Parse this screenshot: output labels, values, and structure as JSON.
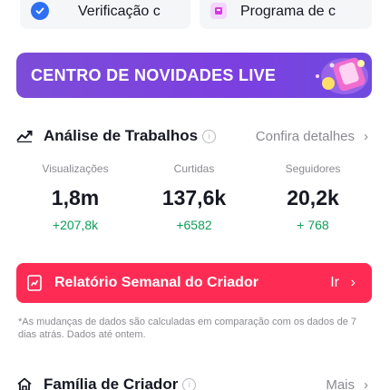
{
  "top_cards": {
    "verification_label": "Verificação c",
    "program_label": "Programa de c"
  },
  "live_banner": {
    "text": "CENTRO DE NOVIDADES LIVE"
  },
  "work_analysis": {
    "title": "Análise de Trabalhos",
    "link": "Confira detalhes",
    "stats": [
      {
        "label": "Visualizações",
        "value": "1,8m",
        "delta": "+207,8k"
      },
      {
        "label": "Curtidas",
        "value": "137,6k",
        "delta": "+6582"
      },
      {
        "label": "Seguidores",
        "value": "20,2k",
        "delta": "+ 768"
      }
    ],
    "delta_color": "#0f9d58"
  },
  "weekly_report": {
    "label": "Relatório Semanal do Criador",
    "action": "Ir",
    "color": "#fe2c55"
  },
  "footnote": "*As mudanças de dados são calculadas em comparação com os dados de 7 dias atrás. Dados até ontem.",
  "creator_family": {
    "title": "Família de Criador",
    "link": "Mais"
  }
}
